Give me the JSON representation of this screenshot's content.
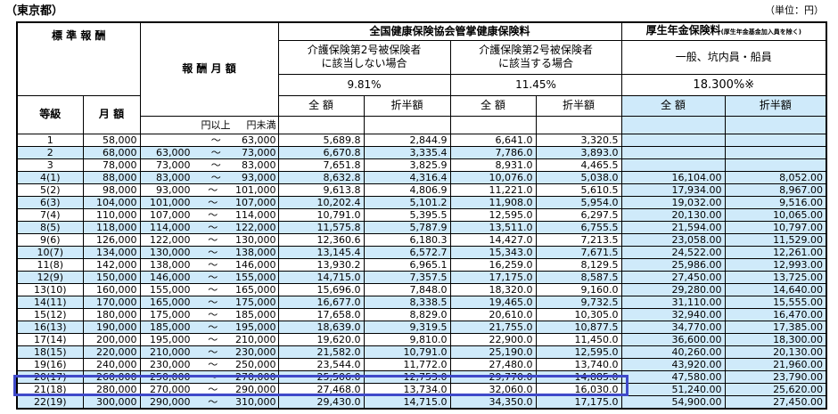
{
  "header": {
    "region": "（東京都）",
    "unit": "（単位：円）"
  },
  "columns": {
    "standard": "標 準 報 酬",
    "grade": "等級",
    "monthly": "月 額",
    "range": "報 酬 月 額",
    "from": "円以上",
    "to": "円未満",
    "tilde": "～",
    "kenpo": "全国健康保険協会管掌健康保険料",
    "kenpo_a1": "介護保険第2号被保険者",
    "kenpo_a2": "に該当しない場合",
    "kenpo_b1": "介護保険第2号被保険者",
    "kenpo_b2": "に該当する場合",
    "rate_a": "9.81%",
    "rate_b": "11.45%",
    "nenkin": "厚生年金保険料",
    "nenkin_note": "(厚生年金基金加入員を除く)",
    "nenkin_type": "一般、坑内員・船員",
    "rate_c": "18.300%※",
    "full": "全 額",
    "half": "折半額"
  },
  "rows": [
    {
      "grade": "1",
      "monthly": "58,000",
      "from": "",
      "to": "63,000",
      "a_full": "5,689.8",
      "a_half": "2,844.9",
      "b_full": "6,641.0",
      "b_half": "3,320.5",
      "c_full": "",
      "c_half": ""
    },
    {
      "grade": "2",
      "monthly": "68,000",
      "from": "63,000",
      "to": "73,000",
      "a_full": "6,670.8",
      "a_half": "3,335.4",
      "b_full": "7,786.0",
      "b_half": "3,893.0",
      "c_full": "",
      "c_half": ""
    },
    {
      "grade": "3",
      "monthly": "78,000",
      "from": "73,000",
      "to": "83,000",
      "a_full": "7,651.8",
      "a_half": "3,825.9",
      "b_full": "8,931.0",
      "b_half": "4,465.5",
      "c_full": "",
      "c_half": ""
    },
    {
      "grade": "4(1)",
      "monthly": "88,000",
      "from": "83,000",
      "to": "93,000",
      "a_full": "8,632.8",
      "a_half": "4,316.4",
      "b_full": "10,076.0",
      "b_half": "5,038.0",
      "c_full": "16,104.00",
      "c_half": "8,052.00"
    },
    {
      "grade": "5(2)",
      "monthly": "98,000",
      "from": "93,000",
      "to": "101,000",
      "a_full": "9,613.8",
      "a_half": "4,806.9",
      "b_full": "11,221.0",
      "b_half": "5,610.5",
      "c_full": "17,934.00",
      "c_half": "8,967.00"
    },
    {
      "grade": "6(3)",
      "monthly": "104,000",
      "from": "101,000",
      "to": "107,000",
      "a_full": "10,202.4",
      "a_half": "5,101.2",
      "b_full": "11,908.0",
      "b_half": "5,954.0",
      "c_full": "19,032.00",
      "c_half": "9,516.00"
    },
    {
      "grade": "7(4)",
      "monthly": "110,000",
      "from": "107,000",
      "to": "114,000",
      "a_full": "10,791.0",
      "a_half": "5,395.5",
      "b_full": "12,595.0",
      "b_half": "6,297.5",
      "c_full": "20,130.00",
      "c_half": "10,065.00"
    },
    {
      "grade": "8(5)",
      "monthly": "118,000",
      "from": "114,000",
      "to": "122,000",
      "a_full": "11,575.8",
      "a_half": "5,787.9",
      "b_full": "13,511.0",
      "b_half": "6,755.5",
      "c_full": "21,594.00",
      "c_half": "10,797.00"
    },
    {
      "grade": "9(6)",
      "monthly": "126,000",
      "from": "122,000",
      "to": "130,000",
      "a_full": "12,360.6",
      "a_half": "6,180.3",
      "b_full": "14,427.0",
      "b_half": "7,213.5",
      "c_full": "23,058.00",
      "c_half": "11,529.00"
    },
    {
      "grade": "10(7)",
      "monthly": "134,000",
      "from": "130,000",
      "to": "138,000",
      "a_full": "13,145.4",
      "a_half": "6,572.7",
      "b_full": "15,343.0",
      "b_half": "7,671.5",
      "c_full": "24,522.00",
      "c_half": "12,261.00"
    },
    {
      "grade": "11(8)",
      "monthly": "142,000",
      "from": "138,000",
      "to": "146,000",
      "a_full": "13,930.2",
      "a_half": "6,965.1",
      "b_full": "16,259.0",
      "b_half": "8,129.5",
      "c_full": "25,986.00",
      "c_half": "12,993.00"
    },
    {
      "grade": "12(9)",
      "monthly": "150,000",
      "from": "146,000",
      "to": "155,000",
      "a_full": "14,715.0",
      "a_half": "7,357.5",
      "b_full": "17,175.0",
      "b_half": "8,587.5",
      "c_full": "27,450.00",
      "c_half": "13,725.00"
    },
    {
      "grade": "13(10)",
      "monthly": "160,000",
      "from": "155,000",
      "to": "165,000",
      "a_full": "15,696.0",
      "a_half": "7,848.0",
      "b_full": "18,320.0",
      "b_half": "9,160.0",
      "c_full": "29,280.00",
      "c_half": "14,640.00"
    },
    {
      "grade": "14(11)",
      "monthly": "170,000",
      "from": "165,000",
      "to": "175,000",
      "a_full": "16,677.0",
      "a_half": "8,338.5",
      "b_full": "19,465.0",
      "b_half": "9,732.5",
      "c_full": "31,110.00",
      "c_half": "15,555.00"
    },
    {
      "grade": "15(12)",
      "monthly": "180,000",
      "from": "175,000",
      "to": "185,000",
      "a_full": "17,658.0",
      "a_half": "8,829.0",
      "b_full": "20,610.0",
      "b_half": "10,305.0",
      "c_full": "32,940.00",
      "c_half": "16,470.00"
    },
    {
      "grade": "16(13)",
      "monthly": "190,000",
      "from": "185,000",
      "to": "195,000",
      "a_full": "18,639.0",
      "a_half": "9,319.5",
      "b_full": "21,755.0",
      "b_half": "10,877.5",
      "c_full": "34,770.00",
      "c_half": "17,385.00"
    },
    {
      "grade": "17(14)",
      "monthly": "200,000",
      "from": "195,000",
      "to": "210,000",
      "a_full": "19,620.0",
      "a_half": "9,810.0",
      "b_full": "22,900.0",
      "b_half": "11,450.0",
      "c_full": "36,600.00",
      "c_half": "18,300.00"
    },
    {
      "grade": "18(15)",
      "monthly": "220,000",
      "from": "210,000",
      "to": "230,000",
      "a_full": "21,582.0",
      "a_half": "10,791.0",
      "b_full": "25,190.0",
      "b_half": "12,595.0",
      "c_full": "40,260.00",
      "c_half": "20,130.00"
    },
    {
      "grade": "19(16)",
      "monthly": "240,000",
      "from": "230,000",
      "to": "250,000",
      "a_full": "23,544.0",
      "a_half": "11,772.0",
      "b_full": "27,480.0",
      "b_half": "13,740.0",
      "c_full": "43,920.00",
      "c_half": "21,960.00"
    },
    {
      "grade": "20(17)",
      "monthly": "260,000",
      "from": "250,000",
      "to": "270,000",
      "a_full": "25,506.0",
      "a_half": "12,753.0",
      "b_full": "29,770.0",
      "b_half": "14,885.0",
      "c_full": "47,580.00",
      "c_half": "23,790.00"
    },
    {
      "grade": "21(18)",
      "monthly": "280,000",
      "from": "270,000",
      "to": "290,000",
      "a_full": "27,468.0",
      "a_half": "13,734.0",
      "b_full": "32,060.0",
      "b_half": "16,030.0",
      "c_full": "51,240.00",
      "c_half": "25,620.00"
    },
    {
      "grade": "22(19)",
      "monthly": "300,000",
      "from": "290,000",
      "to": "310,000",
      "a_full": "29,430.0",
      "a_half": "14,715.0",
      "b_full": "34,350.0",
      "b_half": "17,175.0",
      "c_full": "54,900.00",
      "c_half": "27,450.00"
    }
  ]
}
